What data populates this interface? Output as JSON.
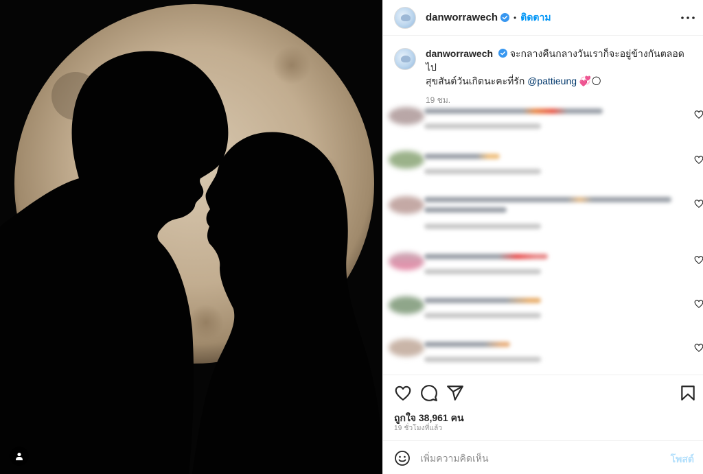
{
  "post": {
    "username": "danworrawech",
    "dot": "•",
    "follow_label": "ติดตาม",
    "more_label": "•••",
    "caption_line1": "จะกลางคืนกลางวันเราก็จะอยู่ข้างกันตลอดไป",
    "caption_line2": "สุขสันต์วันเกิดนะคะที่รัก",
    "mention": "@pattieung",
    "caption_emoji": "💞🌕",
    "caption_time": "19 ชม.",
    "likes": "ถูกใจ 38,961 คน",
    "posted_ago": "19 ชั่วโมงที่แล้ว",
    "comment_placeholder": "เพิ่มความคิดเห็น",
    "post_button": "โพสต์"
  },
  "icons": {
    "verified": "verified-badge-icon",
    "like": "heart-icon",
    "comment": "comment-icon",
    "share": "share-icon",
    "save": "bookmark-icon",
    "emoji": "smiley-icon",
    "tag": "user-tag-icon",
    "more": "more-options-icon"
  },
  "colors": {
    "accent": "#0095f6",
    "mention": "#00376b",
    "verified": "#3897f0",
    "post_disabled": "#b2dffc",
    "muted": "#8e8e8e"
  }
}
